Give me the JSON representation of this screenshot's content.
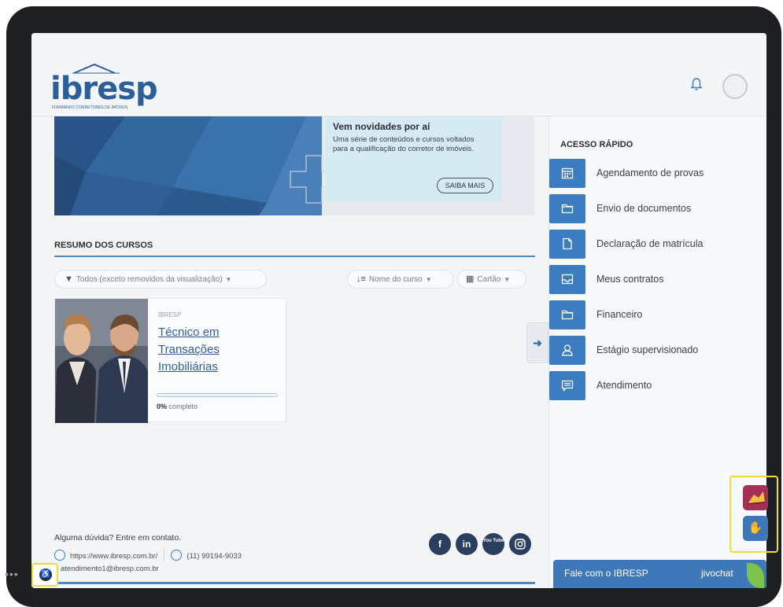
{
  "brand": {
    "logo_text": "ibresp",
    "tagline": "FORMANDO CORRETORES DE IMÓVEIS"
  },
  "header": {
    "bell_icon": "bell-icon",
    "avatar_icon": "user-avatar"
  },
  "promo": {
    "title": "Vem novidades por aí",
    "text": "Uma série de conteúdos e cursos voltados para a qualificação do corretor de imóveis.",
    "button_label": "SAIBA MAIS"
  },
  "course_overview": {
    "title": "RESUMO DOS CURSOS",
    "filter_label": "Todos (exceto removidos da visualização)",
    "sort_label": "Nome do curso",
    "view_label": "Cartão",
    "course": {
      "category": "IBRESP",
      "name": "Técnico em Transações Imobiliárias",
      "progress_value": 0,
      "progress_percent": "0%",
      "progress_suffix": " completo"
    }
  },
  "quick_access": {
    "title": "ACESSO RÁPIDO",
    "items": [
      {
        "label": "Agendamento de provas",
        "icon": "calendar-icon"
      },
      {
        "label": "Envio de documentos",
        "icon": "folder-icon"
      },
      {
        "label": "Declaração de matrícula",
        "icon": "file-icon"
      },
      {
        "label": "Meus contratos",
        "icon": "inbox-icon"
      },
      {
        "label": "Financeiro",
        "icon": "folder-icon"
      },
      {
        "label": "Estágio supervisionado",
        "icon": "user-icon"
      },
      {
        "label": "Atendimento",
        "icon": "message-icon"
      }
    ]
  },
  "footer": {
    "contact_text": "Alguma dúvida? Entre em contato.",
    "website": "https://www.ibresp.com.br/",
    "phone": "(11) 99194-9033",
    "email": "atendimento1@ibresp.com.br",
    "social": [
      "f",
      "in",
      "You Tube",
      "instagram"
    ]
  },
  "chat": {
    "label": "Fale com o IBRESP",
    "brand": "jivochat"
  },
  "colors": {
    "primary": "#3c7cc1",
    "dark_blue": "#2c5f99",
    "highlight": "#f3d83a"
  }
}
